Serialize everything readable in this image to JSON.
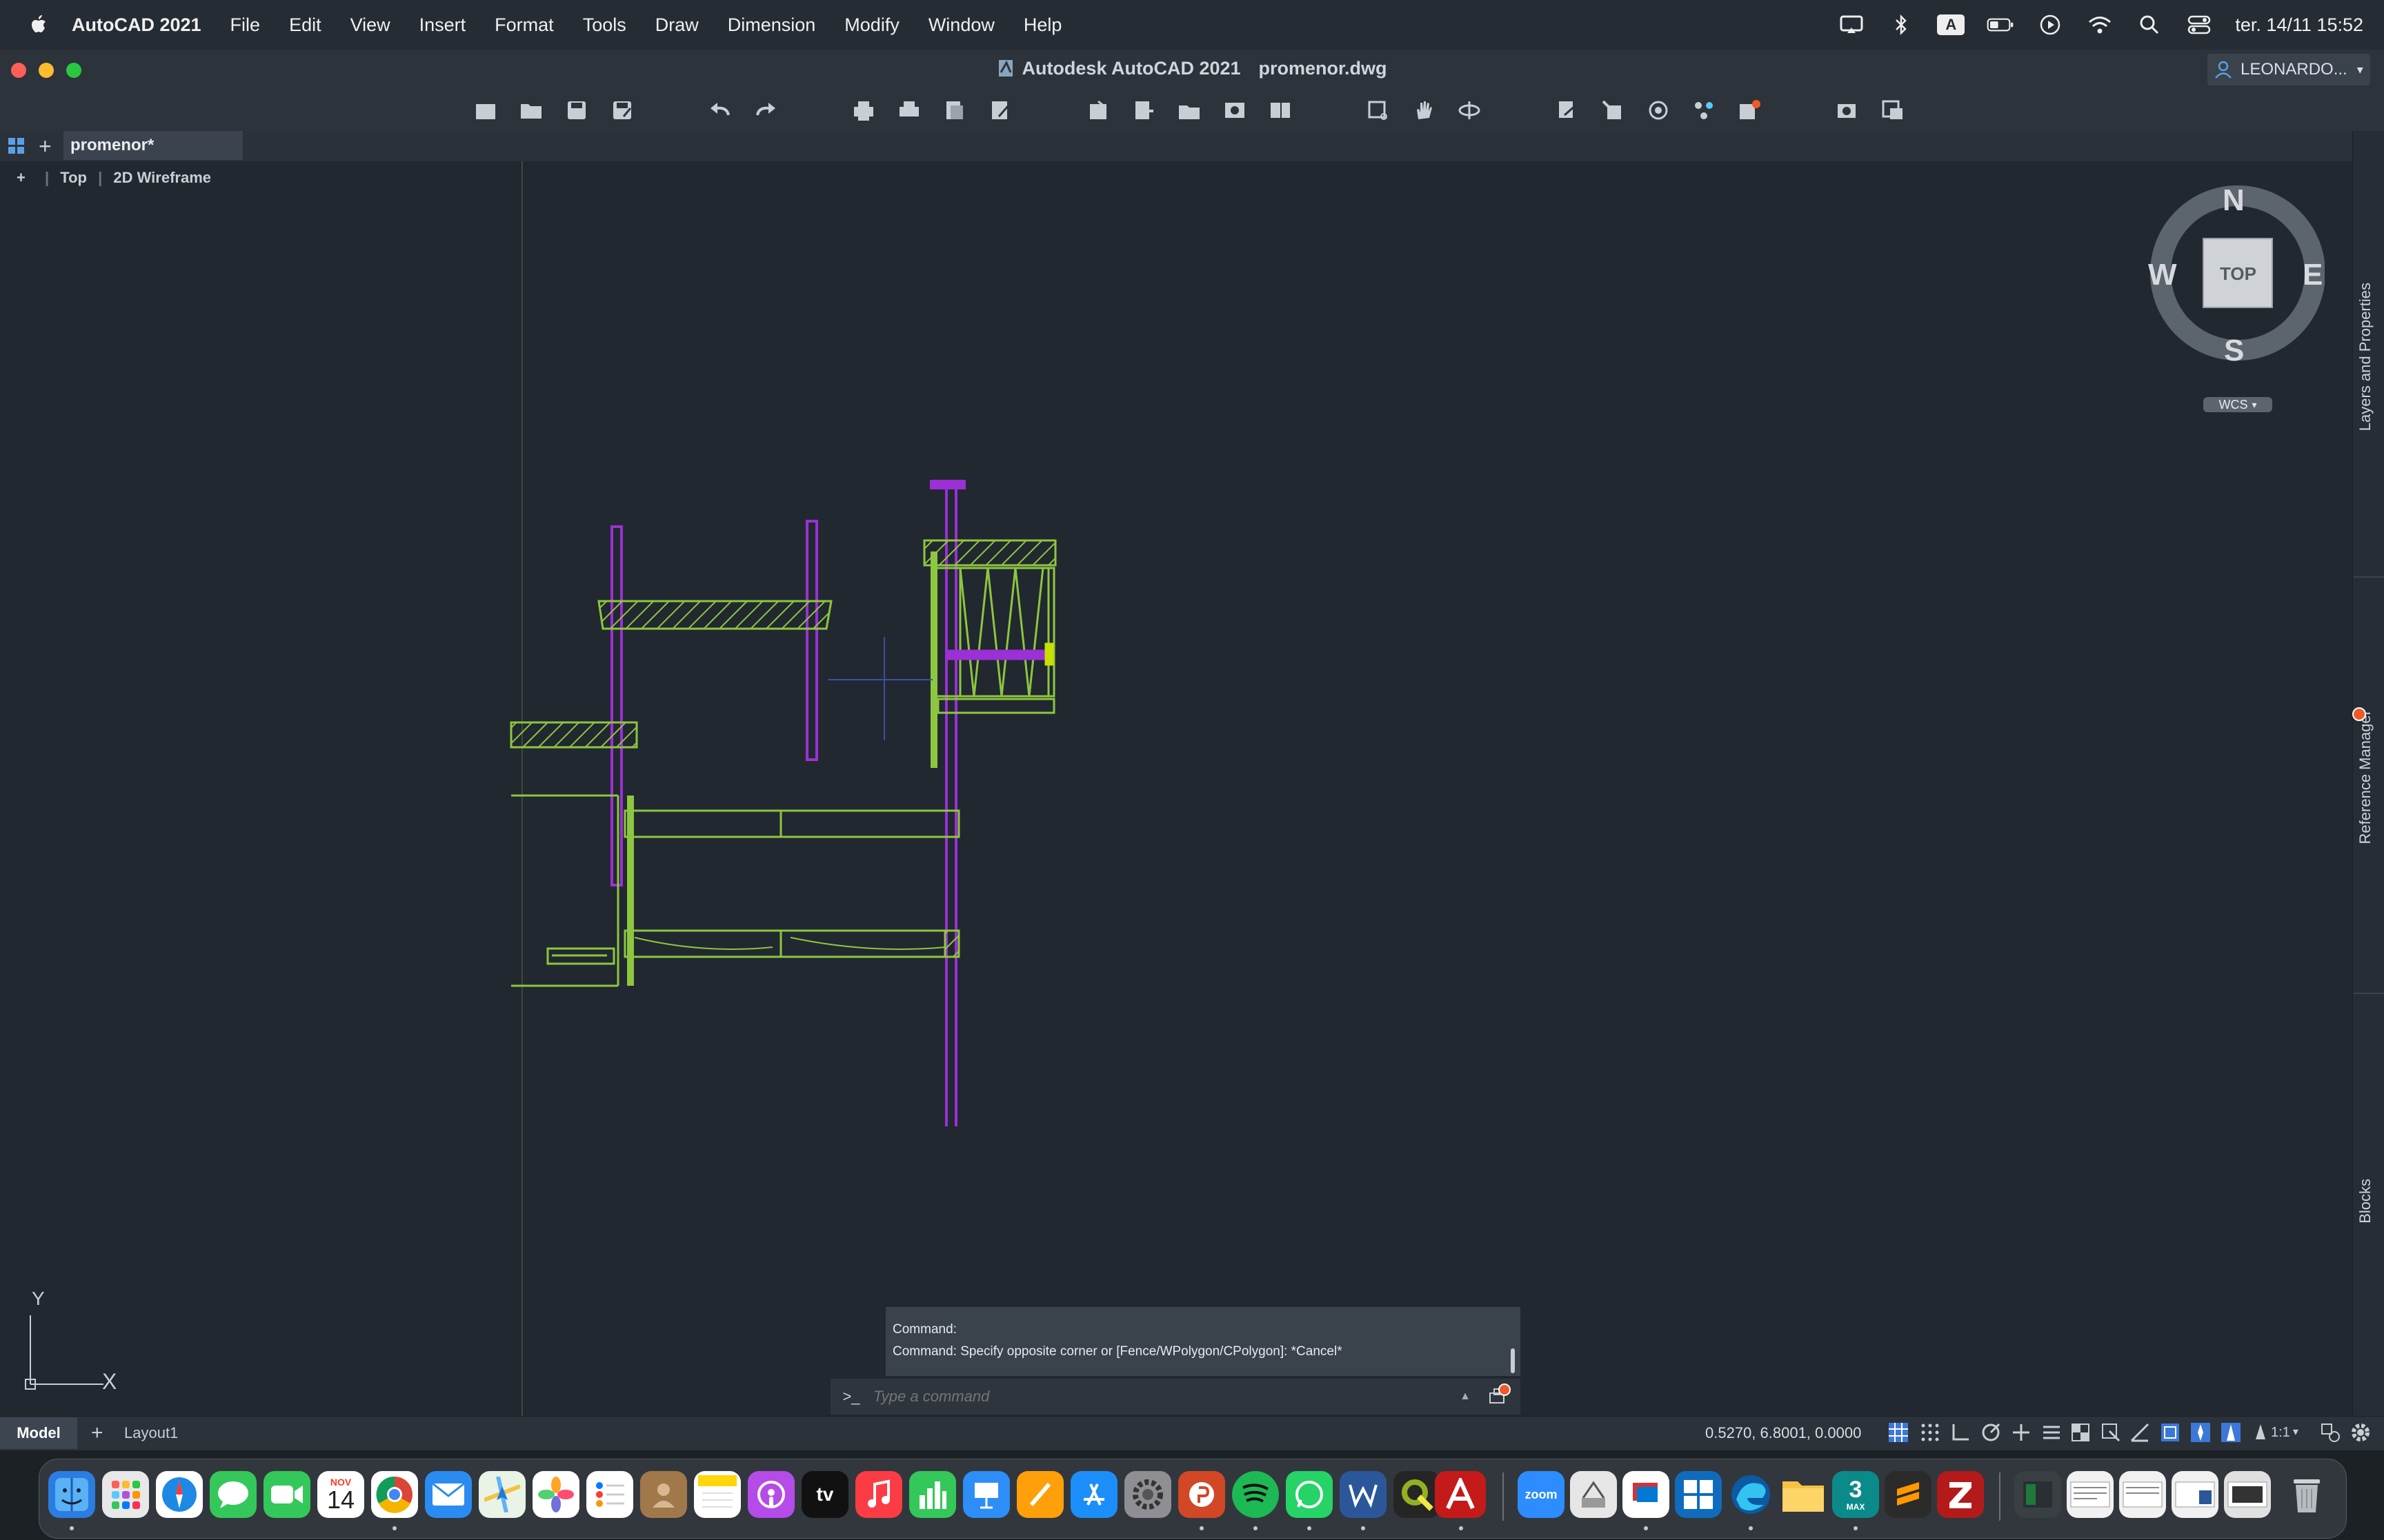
{
  "menubar": {
    "app_name": "AutoCAD 2021",
    "items": [
      "File",
      "Edit",
      "View",
      "Insert",
      "Format",
      "Tools",
      "Draw",
      "Dimension",
      "Modify",
      "Window",
      "Help"
    ],
    "input_source": "A",
    "clock": "ter. 14/11  15:52"
  },
  "window": {
    "title_app": "Autodesk AutoCAD 2021",
    "title_file": "promenor.dwg",
    "user": "LEONARDO..."
  },
  "tabs": {
    "file_tab": "promenor*"
  },
  "viewport": {
    "controls_plus": "+",
    "view_name": "Top",
    "visual_style": "2D Wireframe"
  },
  "viewcube": {
    "north": "N",
    "south": "S",
    "east": "E",
    "west": "W",
    "face": "TOP",
    "ucs": "WCS"
  },
  "ucs_icon": {
    "x": "X",
    "y": "Y"
  },
  "palettes": [
    "Layers and Properties",
    "Reference Manager",
    "Blocks"
  ],
  "command": {
    "history_line_1": "Command:",
    "history_line_2": "Command: Specify opposite corner or [Fence/WPolygon/CPolygon]: *Cancel*",
    "placeholder": "Type a command",
    "prompt_icon": ">_"
  },
  "statusbar": {
    "model_tab": "Model",
    "layout_tab": "Layout1",
    "coordinates": "0.5270,  6.8001, 0.0000",
    "annotation_scale": "1:1"
  },
  "dock": {
    "calendar_month": "NOV",
    "calendar_day": "14",
    "tv_label": "tv",
    "zoom_label": "zoom",
    "max_label": "3",
    "max_sub": "MAX"
  },
  "colors": {
    "geometry_green": "#8dc63f",
    "geometry_purple": "#9b30d6",
    "viewport_bg": "#212830"
  }
}
